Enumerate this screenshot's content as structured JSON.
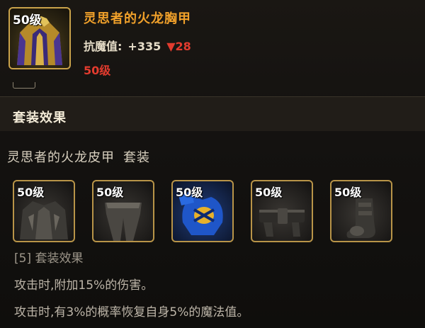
{
  "item": {
    "level_badge": "50级",
    "name": "灵思者的火龙胸甲",
    "stat_label": "抗魔值:",
    "stat_value": "+335",
    "stat_down_arrow": "▼",
    "stat_down_value": "28",
    "required_level": "50级"
  },
  "set": {
    "section_title": "套装效果",
    "set_name": "灵思者的火龙皮甲",
    "set_suffix": "套装",
    "pieces": [
      {
        "level_badge": "50级",
        "icon": "dark-armor-piece-icon",
        "active": false
      },
      {
        "level_badge": "50级",
        "icon": "leg-armor-piece-icon",
        "active": false
      },
      {
        "level_badge": "50级",
        "icon": "shoulder-armor-piece-icon",
        "active": true
      },
      {
        "level_badge": "50级",
        "icon": "belt-piece-icon",
        "active": false
      },
      {
        "level_badge": "50级",
        "icon": "boot-piece-icon",
        "active": false
      }
    ],
    "bonus_header": "[5] 套装效果",
    "bonus_lines": [
      "攻击时,附加15%的伤害。",
      "攻击时,有3%的概率恢复自身5%的魔法值。"
    ]
  },
  "colors": {
    "item_name": "#f0a02a",
    "stat_down": "#e23b2e",
    "frame_gold": "#c9a24a"
  }
}
